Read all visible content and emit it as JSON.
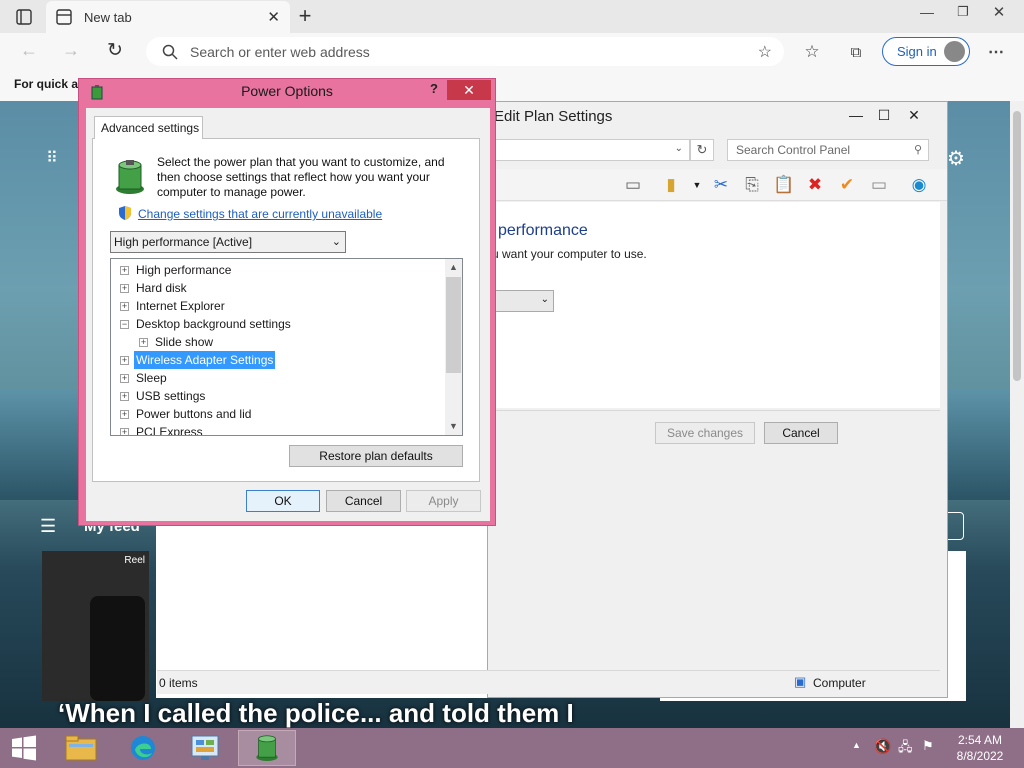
{
  "browser": {
    "tab_title": "New tab",
    "address_placeholder": "Search or enter web address",
    "sign_in_label": "Sign in",
    "favorites_text": "For quick ac"
  },
  "ntp": {
    "headline": "‘When I called the police... and told them I",
    "feed_label": "My feed",
    "card_label": "Reel"
  },
  "control_panel": {
    "title": "Edit Plan Settings",
    "search_placeholder": "Search Control Panel",
    "heading": "performance",
    "subtext": "u want your computer to use.",
    "save_label": "Save changes",
    "cancel_label": "Cancel",
    "status_items": "0 items",
    "status_location": "Computer"
  },
  "power_options": {
    "title": "Power Options",
    "help_label": "?",
    "tab_label": "Advanced settings",
    "description": "Select the power plan that you want to customize, and then choose settings that reflect how you want your computer to manage power.",
    "link": "Change settings that are currently unavailable",
    "plan_selected": "High performance [Active]",
    "tree": [
      {
        "label": "High performance",
        "expander": "+",
        "indent": 0
      },
      {
        "label": "Hard disk",
        "expander": "+",
        "indent": 0
      },
      {
        "label": "Internet Explorer",
        "expander": "+",
        "indent": 0
      },
      {
        "label": "Desktop background settings",
        "expander": "−",
        "indent": 0
      },
      {
        "label": "Slide show",
        "expander": "+",
        "indent": 1
      },
      {
        "label": "Wireless Adapter Settings",
        "expander": "+",
        "indent": 0,
        "selected": true
      },
      {
        "label": "Sleep",
        "expander": "+",
        "indent": 0
      },
      {
        "label": "USB settings",
        "expander": "+",
        "indent": 0
      },
      {
        "label": "Power buttons and lid",
        "expander": "+",
        "indent": 0
      },
      {
        "label": "PCI Express",
        "expander": "+",
        "indent": 0
      }
    ],
    "restore_label": "Restore plan defaults",
    "ok_label": "OK",
    "cancel_label": "Cancel",
    "apply_label": "Apply"
  },
  "taskbar": {
    "time": "2:54 AM",
    "date": "8/8/2022"
  },
  "colors": {
    "dialog_border": "#e7739e",
    "close_red": "#c7384b",
    "link_blue": "#1f5fbf",
    "selection": "#3399ff",
    "taskbar": "#8e6f87"
  }
}
